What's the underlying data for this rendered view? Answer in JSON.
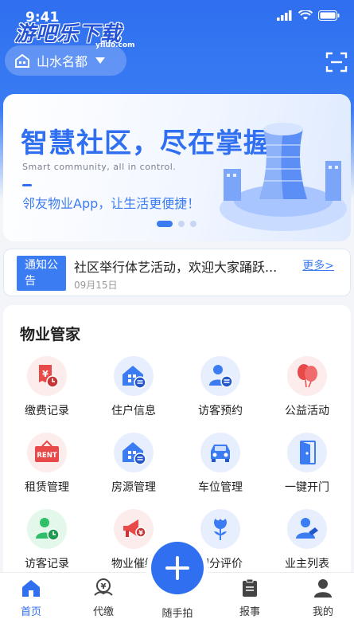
{
  "status_bar": {
    "time": "9:41"
  },
  "watermark": {
    "text": "游吧乐下载",
    "sub": "yfluo.com"
  },
  "header": {
    "location": "山水名都"
  },
  "banner": {
    "title": "智慧社区，尽在掌握。",
    "subtitle": "Smart community, all in control.",
    "slogan": "邻友物业App，让生活更便捷！",
    "pages": 3,
    "active_page": 1
  },
  "notice": {
    "tag": "通知公告",
    "text": "社区举行体艺活动，欢迎大家踊跃...",
    "date": "09月15日",
    "more": "更多>"
  },
  "section": {
    "title": "物业管家",
    "items": [
      {
        "label": "缴费记录",
        "icon": "bill-record-icon"
      },
      {
        "label": "住户信息",
        "icon": "resident-info-icon"
      },
      {
        "label": "访客预约",
        "icon": "visitor-booking-icon"
      },
      {
        "label": "公益活动",
        "icon": "balloon-icon"
      },
      {
        "label": "租赁管理",
        "icon": "rent-sign-icon"
      },
      {
        "label": "房源管理",
        "icon": "house-source-icon"
      },
      {
        "label": "车位管理",
        "icon": "car-icon"
      },
      {
        "label": "一键开门",
        "icon": "door-open-icon"
      },
      {
        "label": "访客记录",
        "icon": "visitor-record-icon"
      },
      {
        "label": "物业催缴",
        "icon": "megaphone-icon"
      },
      {
        "label": "积分评价",
        "icon": "flower-icon"
      },
      {
        "label": "业主列表",
        "icon": "owner-list-icon"
      }
    ]
  },
  "tabbar": {
    "tabs": [
      {
        "label": "首页",
        "icon": "home-icon",
        "active": true
      },
      {
        "label": "代缴",
        "icon": "payment-icon",
        "active": false
      },
      {
        "label": "随手拍",
        "icon": "plus-icon",
        "active": false
      },
      {
        "label": "报事",
        "icon": "report-icon",
        "active": false
      },
      {
        "label": "我的",
        "icon": "profile-icon",
        "active": false
      }
    ]
  },
  "colors": {
    "primary": "#2f6ff0",
    "red": "#e84a4a",
    "green": "#2fbf6a"
  }
}
